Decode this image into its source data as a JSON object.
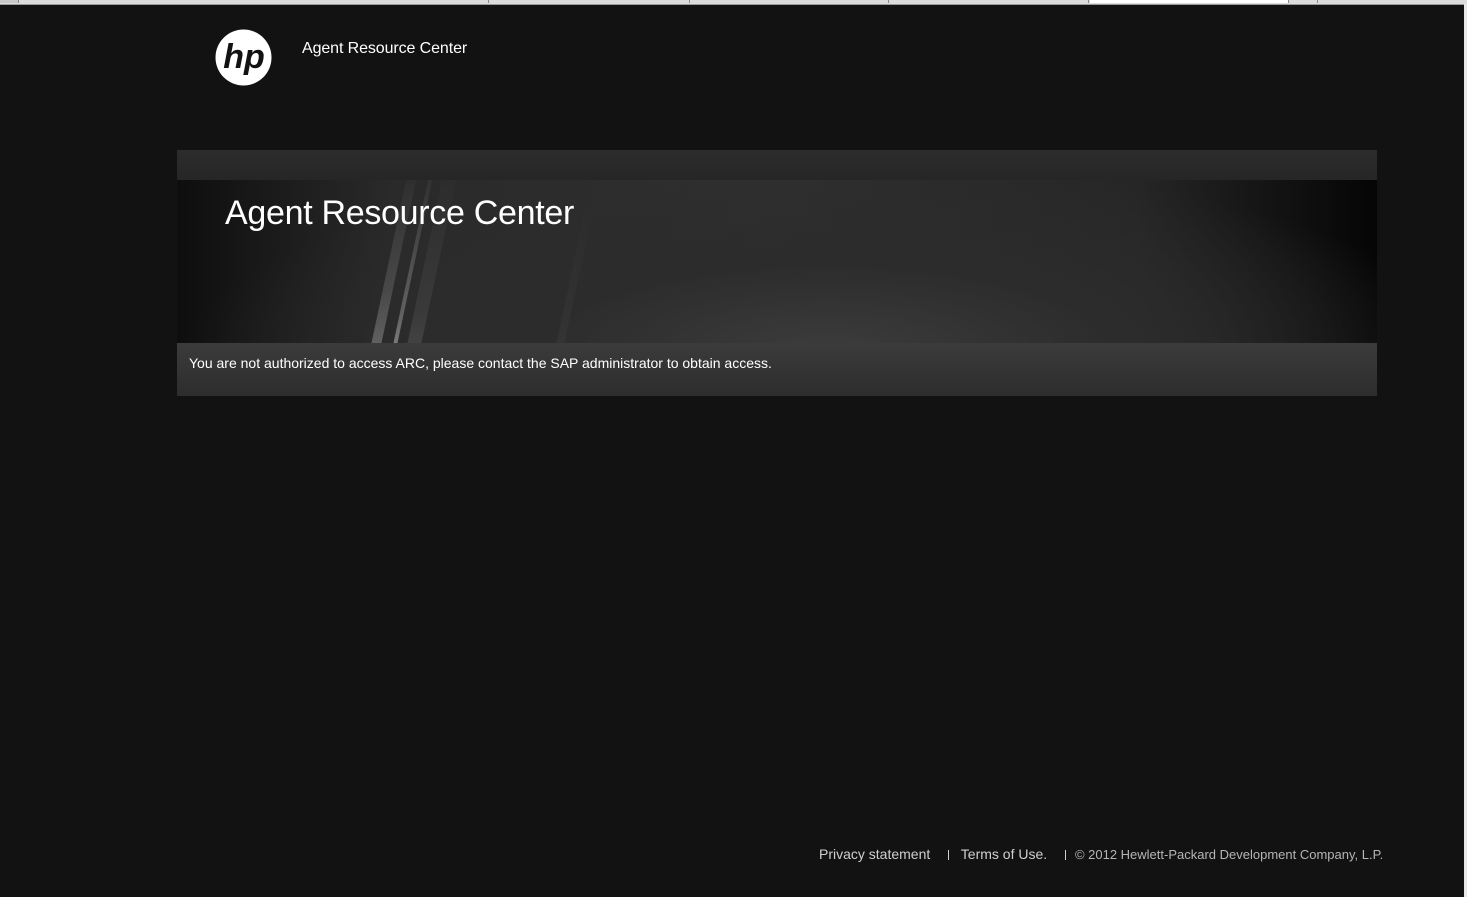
{
  "header": {
    "logo_text": "hp",
    "brand_title": "Agent Resource Center"
  },
  "hero": {
    "title": "Agent Resource Center"
  },
  "notice": {
    "message": "You are not authorized to access ARC, please contact the SAP administrator to obtain access."
  },
  "footer": {
    "privacy_link": "Privacy statement",
    "terms_link": "Terms of Use.",
    "copyright": "© 2012 Hewlett-Packard Development Company, L.P."
  },
  "colors": {
    "page_background": "#121212",
    "text": "#ffffff",
    "footer_text": "#cfcfcf"
  }
}
